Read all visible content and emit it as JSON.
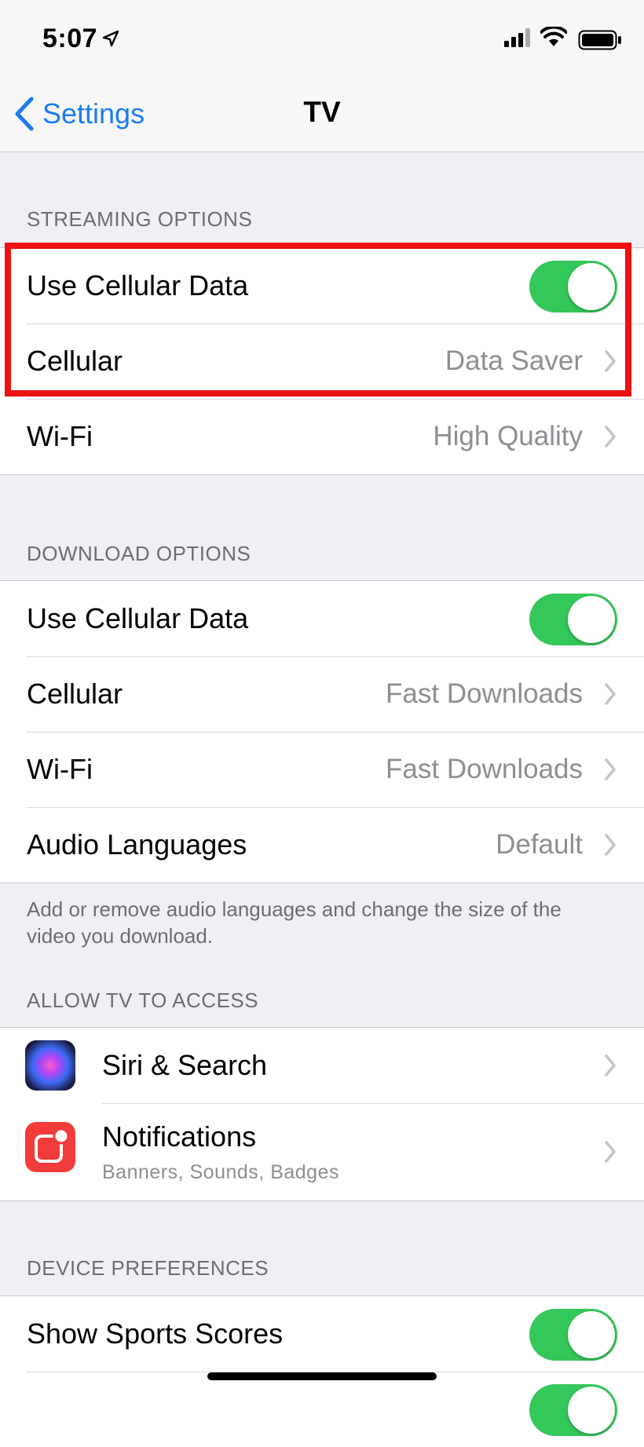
{
  "status_bar": {
    "time": "5:07"
  },
  "nav": {
    "back_label": "Settings",
    "title": "TV"
  },
  "streaming": {
    "header": "STREAMING OPTIONS",
    "use_cellular_label": "Use Cellular Data",
    "use_cellular_on": true,
    "cellular_label": "Cellular",
    "cellular_value": "Data Saver",
    "wifi_label": "Wi-Fi",
    "wifi_value": "High Quality"
  },
  "download": {
    "header": "DOWNLOAD OPTIONS",
    "use_cellular_label": "Use Cellular Data",
    "use_cellular_on": true,
    "cellular_label": "Cellular",
    "cellular_value": "Fast Downloads",
    "wifi_label": "Wi-Fi",
    "wifi_value": "Fast Downloads",
    "audio_label": "Audio Languages",
    "audio_value": "Default",
    "footer": "Add or remove audio languages and change the size of the video you download."
  },
  "access": {
    "header": "ALLOW TV TO ACCESS",
    "siri_label": "Siri & Search",
    "notifications_label": "Notifications",
    "notifications_sub": "Banners, Sounds, Badges"
  },
  "device": {
    "header": "DEVICE PREFERENCES",
    "sports_label": "Show Sports Scores",
    "sports_on": true
  },
  "colors": {
    "accent": "#1a7cf5",
    "toggle_on": "#34c759",
    "highlight": "#ee1111"
  }
}
